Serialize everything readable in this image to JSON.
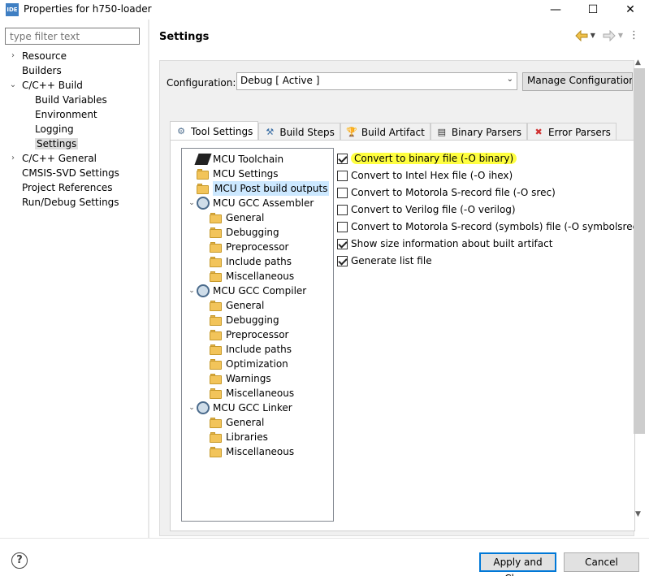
{
  "window": {
    "app_icon_text": "IDE",
    "title": "Properties for h750-loader",
    "minimize": "—",
    "maximize": "☐",
    "close": "✕"
  },
  "left": {
    "filter_placeholder": "type filter text",
    "items": [
      {
        "label": "Resource",
        "twisty": "›",
        "level": 0
      },
      {
        "label": "Builders",
        "twisty": "",
        "level": 0
      },
      {
        "label": "C/C++ Build",
        "twisty": "⌄",
        "level": 0
      },
      {
        "label": "Build Variables",
        "twisty": "",
        "level": 1
      },
      {
        "label": "Environment",
        "twisty": "",
        "level": 1
      },
      {
        "label": "Logging",
        "twisty": "",
        "level": 1
      },
      {
        "label": "Settings",
        "twisty": "",
        "level": 1,
        "selected": true
      },
      {
        "label": "C/C++ General",
        "twisty": "›",
        "level": 0
      },
      {
        "label": "CMSIS-SVD Settings",
        "twisty": "",
        "level": 0
      },
      {
        "label": "Project References",
        "twisty": "",
        "level": 0
      },
      {
        "label": "Run/Debug Settings",
        "twisty": "",
        "level": 0
      }
    ]
  },
  "right": {
    "title": "Settings",
    "configuration_label": "Configuration:",
    "configuration_value": "Debug  [ Active ]",
    "manage_button": "Manage Configurations...",
    "tabs": [
      {
        "label": "Tool Settings",
        "icon": "tool-settings-icon",
        "active": true
      },
      {
        "label": "Build Steps",
        "icon": "build-steps-icon"
      },
      {
        "label": "Build Artifact",
        "icon": "build-artifact-icon"
      },
      {
        "label": "Binary Parsers",
        "icon": "binary-parsers-icon"
      },
      {
        "label": "Error Parsers",
        "icon": "error-parsers-icon"
      }
    ],
    "tree": [
      {
        "label": "MCU Toolchain",
        "icon": "chip",
        "tw": "",
        "indent": 0
      },
      {
        "label": "MCU Settings",
        "icon": "folder",
        "tw": "",
        "indent": 0
      },
      {
        "label": "MCU Post build outputs",
        "icon": "folder",
        "tw": "",
        "indent": 0,
        "selected": true
      },
      {
        "label": "MCU GCC Assembler",
        "icon": "gear",
        "tw": "⌄",
        "indent": 0
      },
      {
        "label": "General",
        "icon": "folder",
        "tw": "",
        "indent": 1
      },
      {
        "label": "Debugging",
        "icon": "folder",
        "tw": "",
        "indent": 1
      },
      {
        "label": "Preprocessor",
        "icon": "folder",
        "tw": "",
        "indent": 1
      },
      {
        "label": "Include paths",
        "icon": "folder",
        "tw": "",
        "indent": 1
      },
      {
        "label": "Miscellaneous",
        "icon": "folder",
        "tw": "",
        "indent": 1
      },
      {
        "label": "MCU GCC Compiler",
        "icon": "gear",
        "tw": "⌄",
        "indent": 0
      },
      {
        "label": "General",
        "icon": "folder",
        "tw": "",
        "indent": 1
      },
      {
        "label": "Debugging",
        "icon": "folder",
        "tw": "",
        "indent": 1
      },
      {
        "label": "Preprocessor",
        "icon": "folder",
        "tw": "",
        "indent": 1
      },
      {
        "label": "Include paths",
        "icon": "folder",
        "tw": "",
        "indent": 1
      },
      {
        "label": "Optimization",
        "icon": "folder",
        "tw": "",
        "indent": 1
      },
      {
        "label": "Warnings",
        "icon": "folder",
        "tw": "",
        "indent": 1
      },
      {
        "label": "Miscellaneous",
        "icon": "folder",
        "tw": "",
        "indent": 1
      },
      {
        "label": "MCU GCC Linker",
        "icon": "gear",
        "tw": "⌄",
        "indent": 0
      },
      {
        "label": "General",
        "icon": "folder",
        "tw": "",
        "indent": 1
      },
      {
        "label": "Libraries",
        "icon": "folder",
        "tw": "",
        "indent": 1
      },
      {
        "label": "Miscellaneous",
        "icon": "folder",
        "tw": "",
        "indent": 1
      }
    ],
    "options": [
      {
        "label": "Convert to binary file (-O binary)",
        "checked": true,
        "highlighted": true
      },
      {
        "label": "Convert to Intel Hex file (-O ihex)",
        "checked": false
      },
      {
        "label": "Convert to Motorola S-record file (-O srec)",
        "checked": false
      },
      {
        "label": "Convert to Verilog file (-O verilog)",
        "checked": false
      },
      {
        "label": "Convert to Motorola S-record (symbols) file (-O symbolsrec)",
        "checked": false
      },
      {
        "label": "Show size information about built artifact",
        "checked": true
      },
      {
        "label": "Generate list file",
        "checked": true
      }
    ]
  },
  "bottom": {
    "help": "?",
    "apply_close": "Apply and Close",
    "cancel": "Cancel"
  },
  "colors": {
    "highlight": "#ffff40",
    "selection": "#cce8ff",
    "primary_border": "#0078d7"
  }
}
